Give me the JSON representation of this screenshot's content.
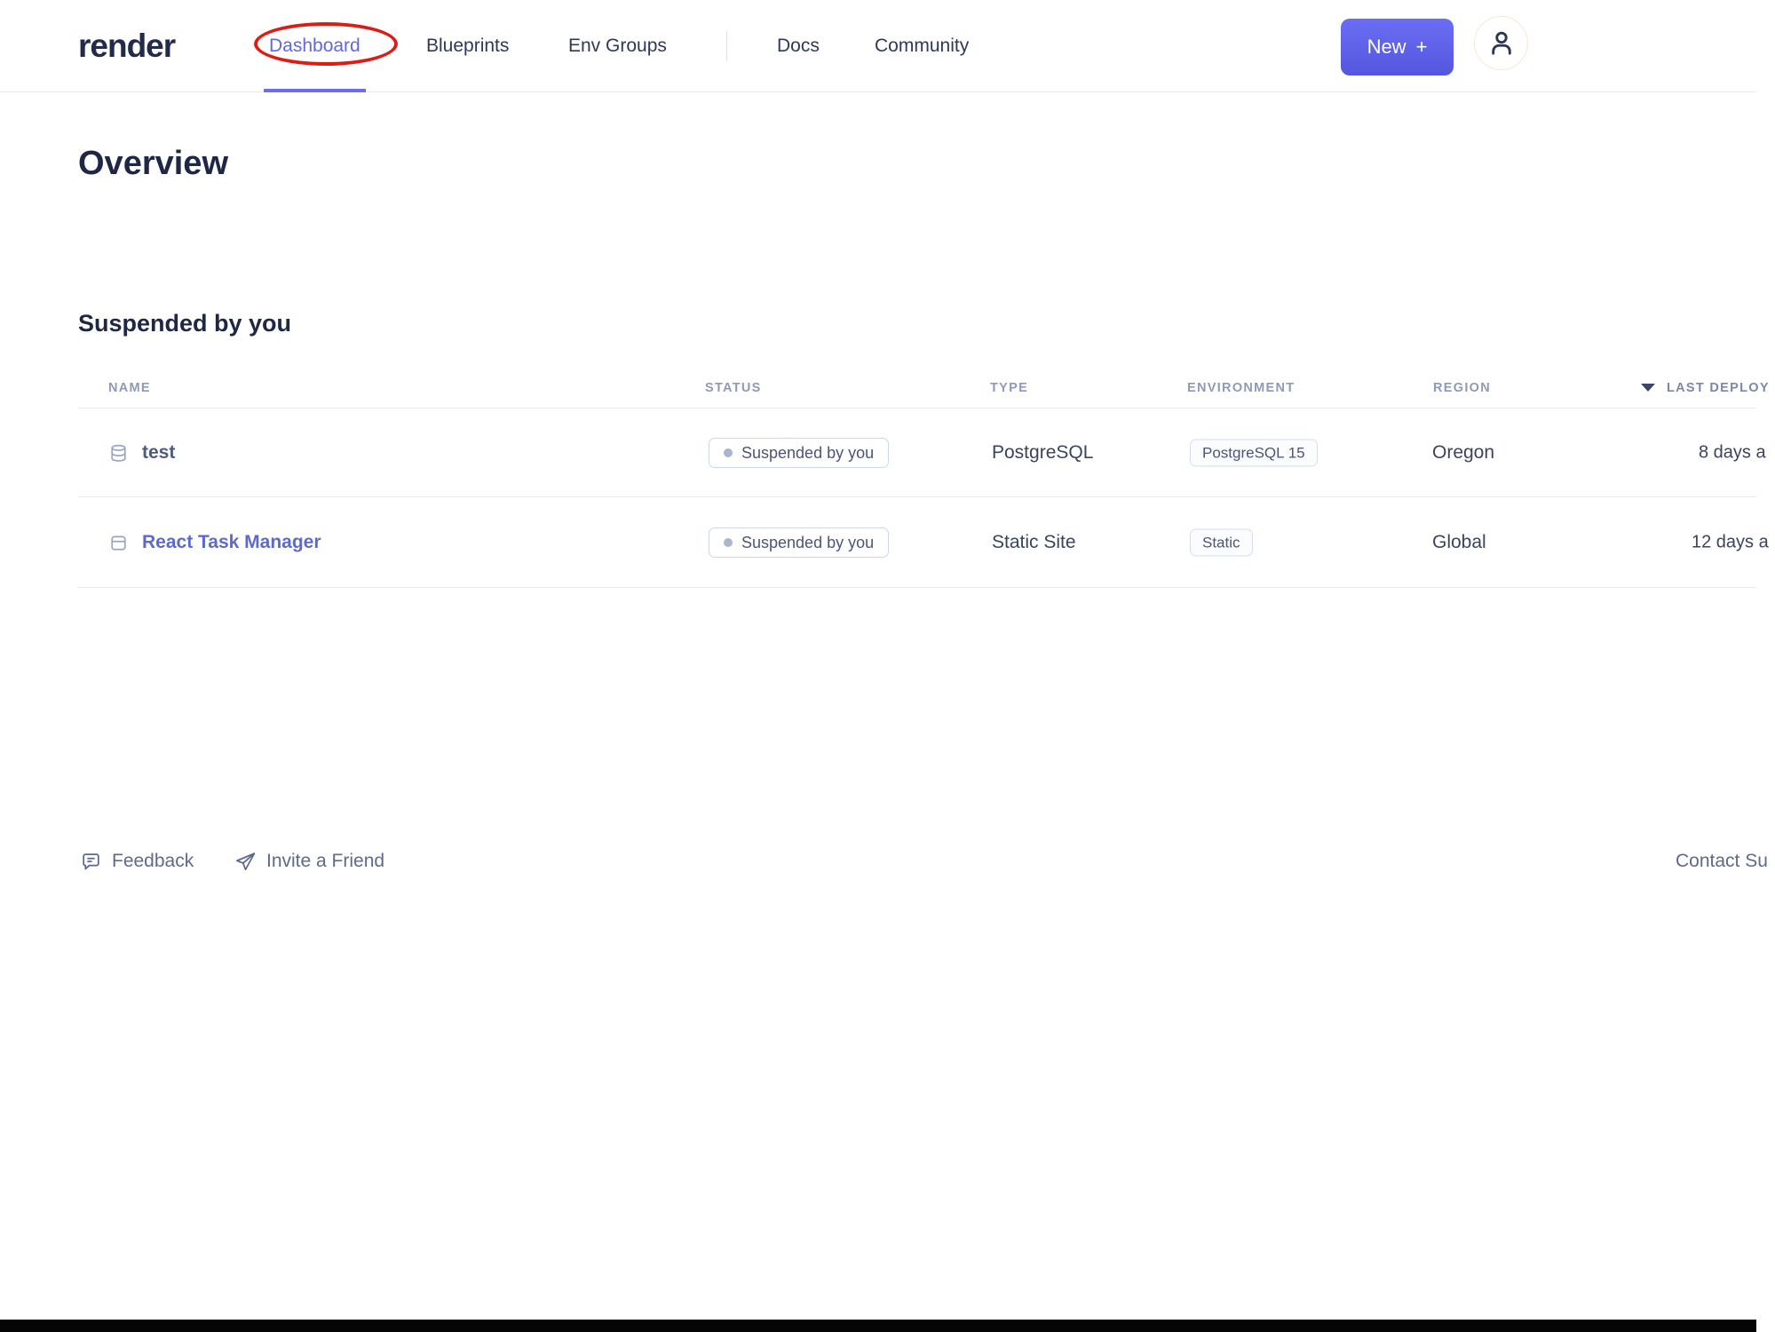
{
  "brand": {
    "logo": "render"
  },
  "nav": {
    "items": [
      {
        "label": "Dashboard",
        "active": true
      },
      {
        "label": "Blueprints",
        "active": false
      },
      {
        "label": "Env Groups",
        "active": false
      },
      {
        "label": "Docs",
        "active": false
      },
      {
        "label": "Community",
        "active": false
      }
    ],
    "new_button": {
      "label": "New",
      "plus": "+"
    }
  },
  "page": {
    "title": "Overview",
    "section_title": "Suspended by you"
  },
  "table": {
    "columns": [
      "NAME",
      "STATUS",
      "TYPE",
      "ENVIRONMENT",
      "REGION",
      "LAST DEPLOY"
    ],
    "sort": {
      "column": "LAST DEPLOY",
      "direction": "desc"
    },
    "rows": [
      {
        "name": "test",
        "icon": "database-icon",
        "status": "Suspended by you",
        "type": "PostgreSQL",
        "environment": "PostgreSQL 15",
        "region": "Oregon",
        "last_deploy": "8 days a"
      },
      {
        "name": "React Task Manager",
        "icon": "static-site-icon",
        "status": "Suspended by you",
        "type": "Static Site",
        "environment": "Static",
        "region": "Global",
        "last_deploy": "12 days a"
      }
    ]
  },
  "footer": {
    "feedback": "Feedback",
    "invite": "Invite a Friend",
    "contact": "Contact Su"
  },
  "annotation": {
    "shape": "ellipse",
    "target": "Dashboard",
    "color": "#dd1d15"
  },
  "colors": {
    "accent_purple": "#5c5fe8",
    "nav_active": "#6166ea",
    "brand_text": "#222b4a",
    "heading_text": "#1e2746",
    "table_header_text": "#9099b8",
    "body_text": "#39445f",
    "badge_border": "#ccd7ea",
    "status_dot": "#a9b6d2",
    "link_indigo": "#5d6bc8",
    "annotation_red": "#dd1d15"
  }
}
